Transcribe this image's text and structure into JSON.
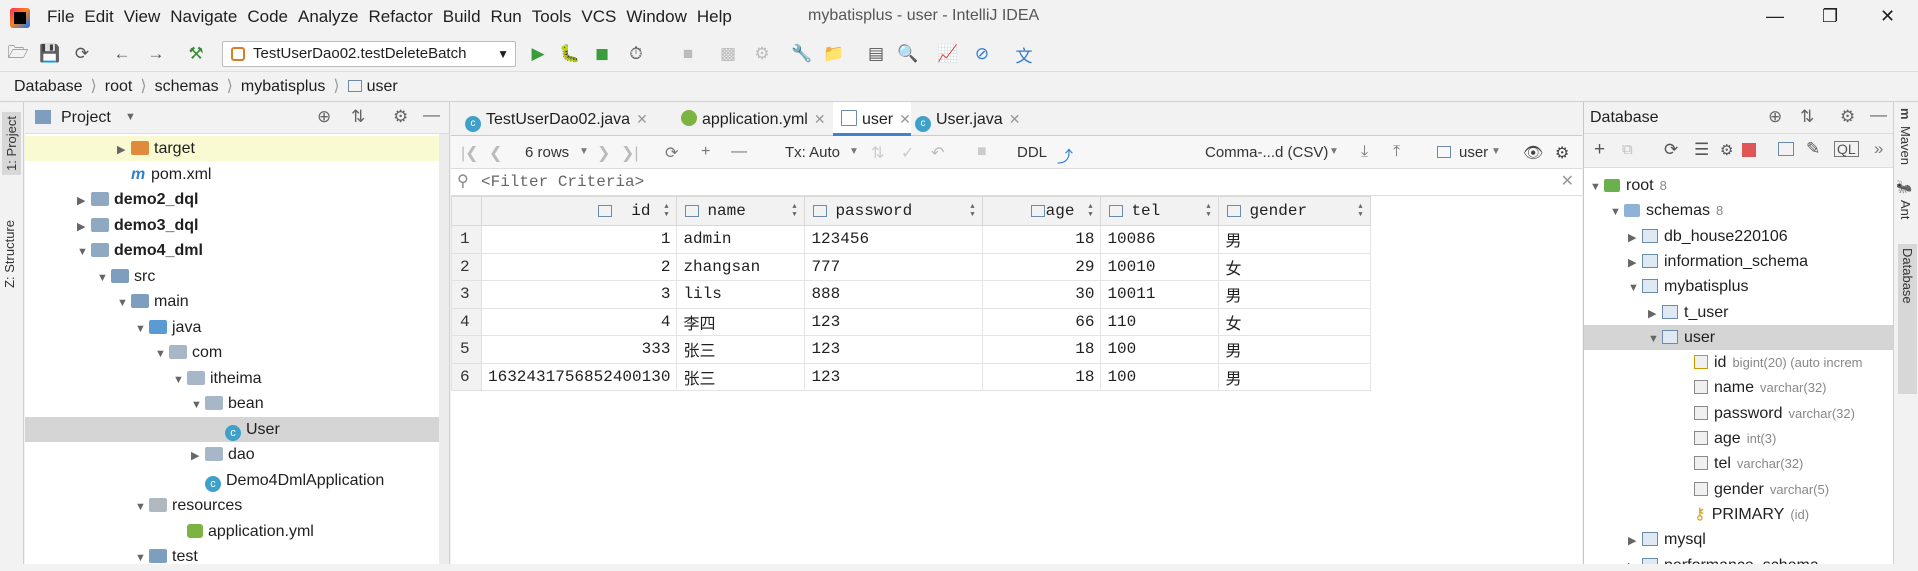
{
  "menu": [
    "File",
    "Edit",
    "View",
    "Navigate",
    "Code",
    "Analyze",
    "Refactor",
    "Build",
    "Run",
    "Tools",
    "VCS",
    "Window",
    "Help"
  ],
  "window_title": "mybatisplus - user - IntelliJ IDEA",
  "run_config": "TestUserDao02.testDeleteBatch",
  "breadcrumb": [
    "Database",
    "root",
    "schemas",
    "mybatisplus",
    "user"
  ],
  "left_tabs": [
    "1: Project",
    "Z: Structure"
  ],
  "right_tabs": [
    "Maven",
    "Ant",
    "Database"
  ],
  "project": {
    "title": "Project",
    "tree": [
      {
        "label": "target",
        "icon": "folder-orange",
        "depth": 2,
        "arrow": "right",
        "bold": false
      },
      {
        "label": "pom.xml",
        "icon": "maven-file",
        "depth": 2,
        "arrow": "",
        "bold": false
      },
      {
        "label": "demo2_dql",
        "icon": "module",
        "depth": 0,
        "arrow": "right",
        "bold": true
      },
      {
        "label": "demo3_dql",
        "icon": "module",
        "depth": 0,
        "arrow": "right",
        "bold": true
      },
      {
        "label": "demo4_dml",
        "icon": "module",
        "depth": 0,
        "arrow": "down",
        "bold": true
      },
      {
        "label": "src",
        "icon": "folder",
        "depth": 1,
        "arrow": "down",
        "bold": false
      },
      {
        "label": "main",
        "icon": "folder",
        "depth": 2,
        "arrow": "down",
        "bold": false
      },
      {
        "label": "java",
        "icon": "folder-src",
        "depth": 3,
        "arrow": "down",
        "bold": false
      },
      {
        "label": "com",
        "icon": "package",
        "depth": 4,
        "arrow": "down",
        "bold": false
      },
      {
        "label": "itheima",
        "icon": "package",
        "depth": 5,
        "arrow": "down",
        "bold": false
      },
      {
        "label": "bean",
        "icon": "package",
        "depth": 6,
        "arrow": "down",
        "bold": false
      },
      {
        "label": "User",
        "icon": "class",
        "depth": 7,
        "arrow": "",
        "bold": false
      },
      {
        "label": "dao",
        "icon": "package",
        "depth": 6,
        "arrow": "right",
        "bold": false
      },
      {
        "label": "Demo4DmlApplication",
        "icon": "class",
        "depth": 6,
        "arrow": "",
        "bold": false
      },
      {
        "label": "resources",
        "icon": "folder-res",
        "depth": 3,
        "arrow": "down",
        "bold": false
      },
      {
        "label": "application.yml",
        "icon": "yml",
        "depth": 5,
        "arrow": "",
        "bold": false
      },
      {
        "label": "test",
        "icon": "folder",
        "depth": 3,
        "arrow": "down",
        "bold": false
      }
    ]
  },
  "editor": {
    "tabs": [
      {
        "label": "TestUserDao02.java",
        "icon": "class"
      },
      {
        "label": "application.yml",
        "icon": "yml"
      },
      {
        "label": "user",
        "icon": "table"
      },
      {
        "label": "User.java",
        "icon": "class"
      }
    ],
    "active_tab": "user",
    "grid_toolbar": {
      "rows": "6 rows",
      "tx": "Tx: Auto",
      "ddl": "DDL",
      "format": "Comma-...d (CSV)",
      "table": "user"
    },
    "filter_placeholder": "<Filter Criteria>",
    "columns": [
      "id",
      "name",
      "password",
      "age",
      "tel",
      "gender"
    ],
    "rows": [
      [
        "1",
        "1",
        "admin",
        "123456",
        "18",
        "10086",
        "男"
      ],
      [
        "2",
        "2",
        "zhangsan",
        "777",
        "29",
        "10010",
        "女"
      ],
      [
        "3",
        "3",
        "lils",
        "888",
        "30",
        "10011",
        "男"
      ],
      [
        "4",
        "4",
        "李四",
        "123",
        "66",
        "110",
        "女"
      ],
      [
        "5",
        "333",
        "张三",
        "123",
        "18",
        "100",
        "男"
      ],
      [
        "6",
        "1632431756852400130",
        "张三",
        "123",
        "18",
        "100",
        "男"
      ]
    ]
  },
  "database": {
    "title": "Database",
    "tree": [
      {
        "label": "root",
        "extra": "8",
        "icon": "datasource",
        "depth": 0,
        "arrow": "down"
      },
      {
        "label": "schemas",
        "extra": "8",
        "icon": "folder",
        "depth": 1,
        "arrow": "down"
      },
      {
        "label": "db_house220106",
        "extra": "",
        "icon": "schema",
        "depth": 2,
        "arrow": "right"
      },
      {
        "label": "information_schema",
        "extra": "",
        "icon": "schema",
        "depth": 2,
        "arrow": "right"
      },
      {
        "label": "mybatisplus",
        "extra": "",
        "icon": "schema",
        "depth": 2,
        "arrow": "down"
      },
      {
        "label": "t_user",
        "extra": "",
        "icon": "table",
        "depth": 3,
        "arrow": "right"
      },
      {
        "label": "user",
        "extra": "",
        "icon": "table",
        "depth": 3,
        "arrow": "down"
      },
      {
        "label": "id",
        "extra": "bigint(20) (auto increm",
        "icon": "key-column",
        "depth": 4,
        "arrow": ""
      },
      {
        "label": "name",
        "extra": "varchar(32)",
        "icon": "column",
        "depth": 4,
        "arrow": ""
      },
      {
        "label": "password",
        "extra": "varchar(32)",
        "icon": "column",
        "depth": 4,
        "arrow": ""
      },
      {
        "label": "age",
        "extra": "int(3)",
        "icon": "column",
        "depth": 4,
        "arrow": ""
      },
      {
        "label": "tel",
        "extra": "varchar(32)",
        "icon": "column",
        "depth": 4,
        "arrow": ""
      },
      {
        "label": "gender",
        "extra": "varchar(5)",
        "icon": "column",
        "depth": 4,
        "arrow": ""
      },
      {
        "label": "PRIMARY",
        "extra": "(id)",
        "icon": "key",
        "depth": 4,
        "arrow": ""
      },
      {
        "label": "mysql",
        "extra": "",
        "icon": "schema",
        "depth": 2,
        "arrow": "right"
      },
      {
        "label": "performance_schema",
        "extra": "",
        "icon": "schema",
        "depth": 2,
        "arrow": "right"
      }
    ]
  }
}
